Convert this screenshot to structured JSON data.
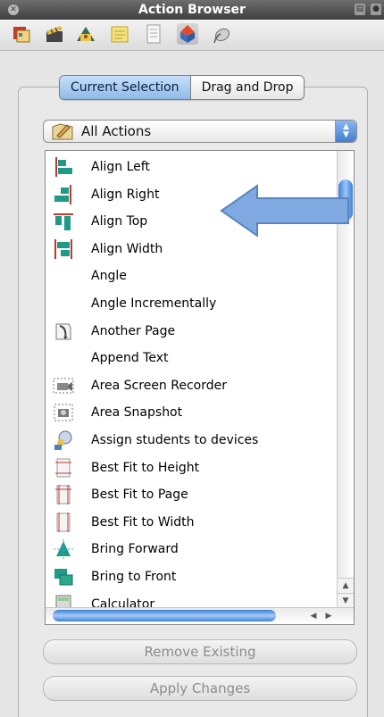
{
  "window": {
    "title": "Action Browser"
  },
  "toolbar": {
    "icons": [
      "resources-icon",
      "movie-icon",
      "workshop-icon",
      "notes-icon",
      "properties-icon",
      "action-icon",
      "mouse-icon"
    ]
  },
  "tabs": [
    {
      "label": "Current Selection",
      "active": true
    },
    {
      "label": "Drag and Drop",
      "active": false
    }
  ],
  "filter": {
    "selected": "All Actions"
  },
  "actions": [
    {
      "label": "Align Left",
      "icon": "align-left-icon"
    },
    {
      "label": "Align Right",
      "icon": "align-right-icon"
    },
    {
      "label": "Align Top",
      "icon": "align-top-icon"
    },
    {
      "label": "Align Width",
      "icon": "align-width-icon"
    },
    {
      "label": "Angle",
      "icon": ""
    },
    {
      "label": "Angle Incrementally",
      "icon": ""
    },
    {
      "label": "Another Page",
      "icon": "page-curl-icon"
    },
    {
      "label": "Append Text",
      "icon": ""
    },
    {
      "label": "Area Screen Recorder",
      "icon": "camera-icon"
    },
    {
      "label": "Area Snapshot",
      "icon": "snapshot-icon"
    },
    {
      "label": "Assign students to devices",
      "icon": "assign-students-icon"
    },
    {
      "label": "Best Fit to Height",
      "icon": "fit-height-icon"
    },
    {
      "label": "Best Fit to Page",
      "icon": "fit-page-icon"
    },
    {
      "label": "Best Fit to Width",
      "icon": "fit-width-icon"
    },
    {
      "label": "Bring Forward",
      "icon": "bring-forward-icon"
    },
    {
      "label": "Bring to Front",
      "icon": "bring-to-front-icon"
    },
    {
      "label": "Calculator",
      "icon": "calculator-icon"
    }
  ],
  "buttons": {
    "remove": "Remove Existing",
    "apply": "Apply Changes"
  },
  "colors": {
    "accent": "#3f7fd1",
    "arrow_fill": "#7fa9e0",
    "selected_tab": "#a9cdf2"
  }
}
